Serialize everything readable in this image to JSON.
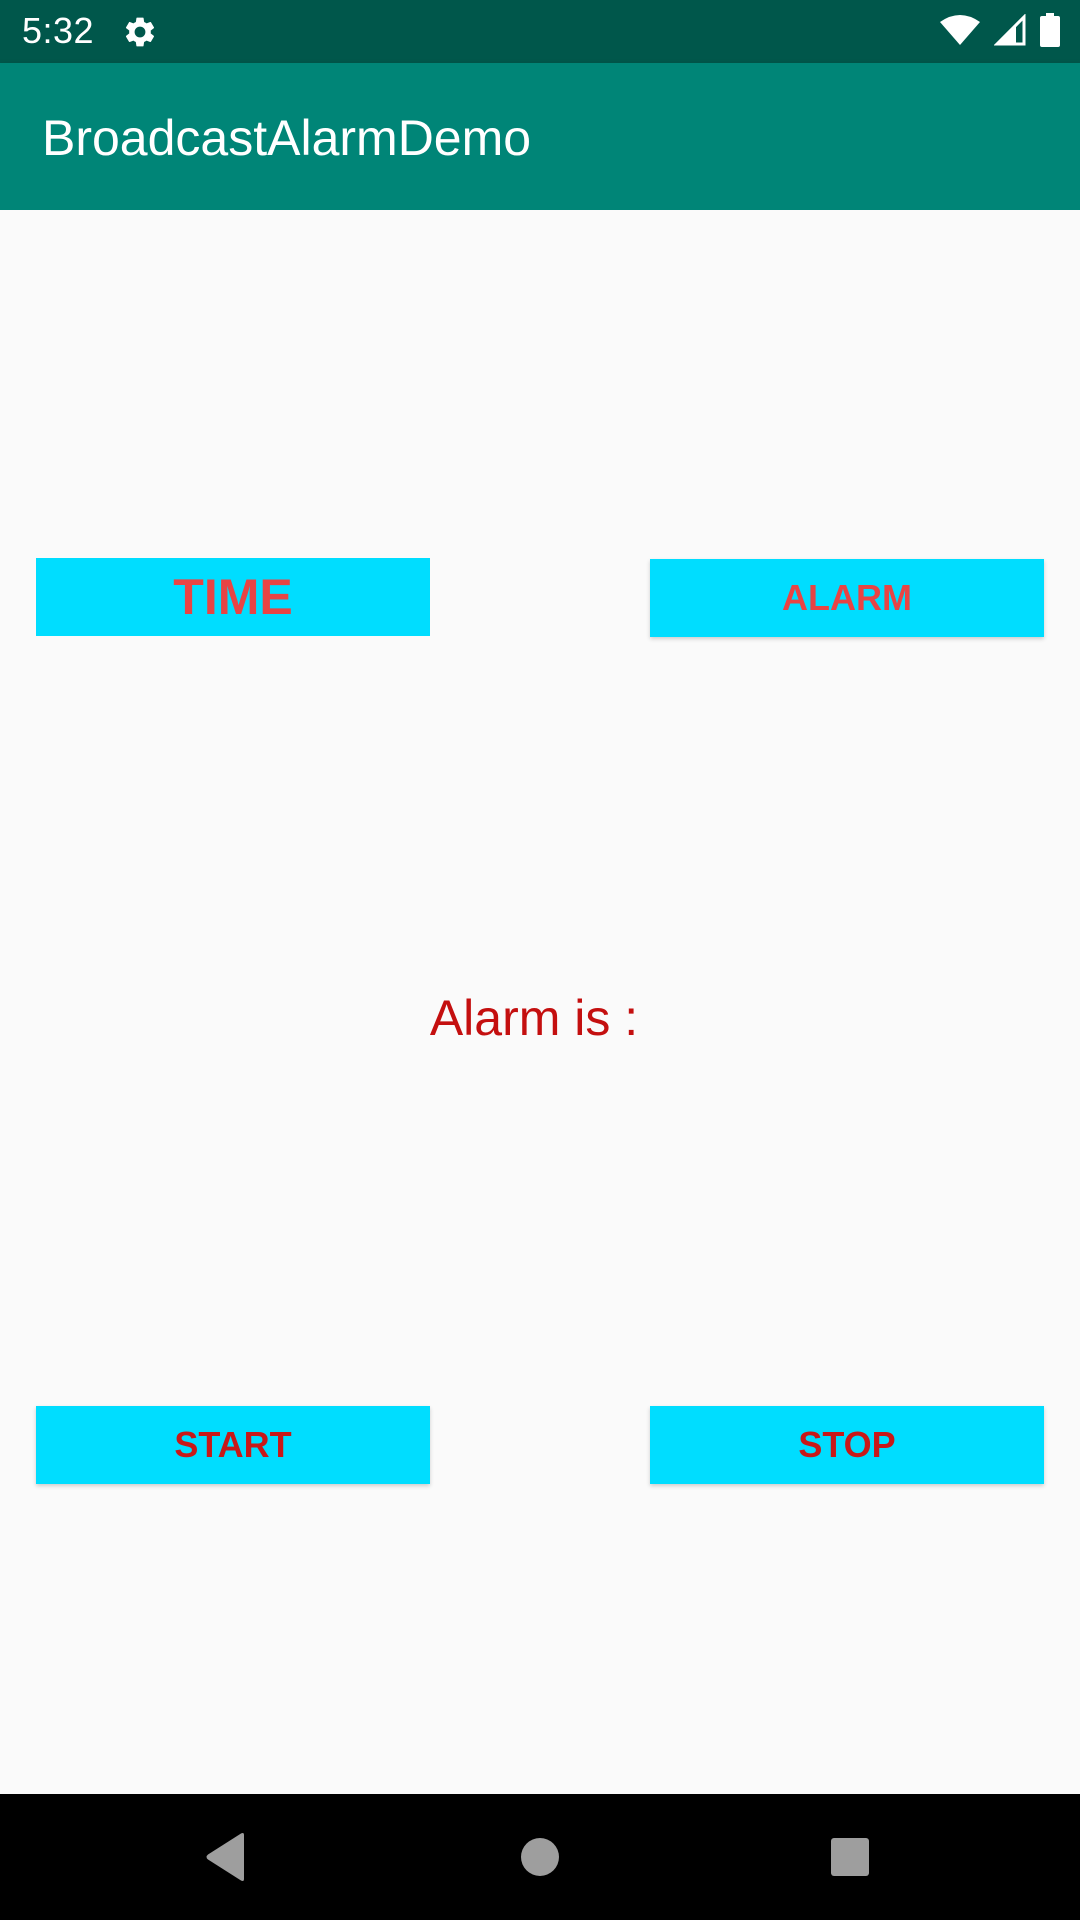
{
  "status_bar": {
    "time": "5:32",
    "icons": [
      "settings-icon",
      "wifi-icon",
      "cell-signal-icon",
      "battery-icon"
    ],
    "color": "#00574b"
  },
  "app_bar": {
    "title": "BroadcastAlarmDemo",
    "color": "#008577"
  },
  "main": {
    "time_button_label": "TIME",
    "alarm_button_label": "ALARM",
    "alarm_status_label": "Alarm is :",
    "start_button_label": "START",
    "stop_button_label": "STOP",
    "button_color": "#00ddff",
    "text_color": "#e84444"
  },
  "nav_bar": {
    "icons": [
      "back-icon",
      "home-icon",
      "recents-icon"
    ]
  }
}
